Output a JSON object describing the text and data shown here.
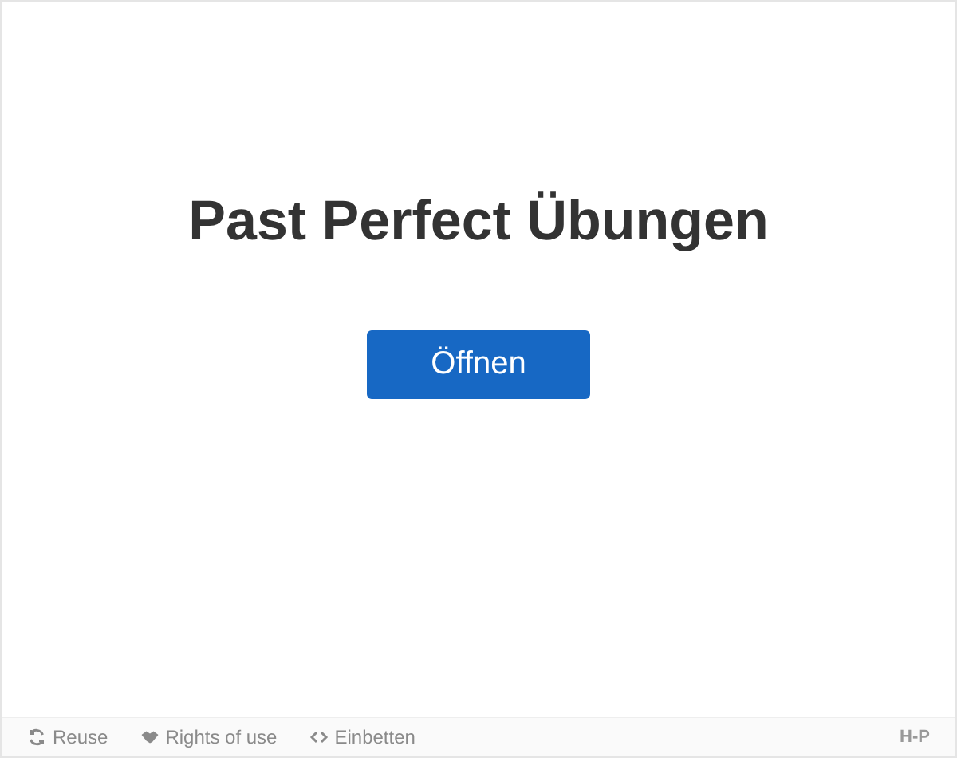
{
  "title": "Past Perfect Übungen",
  "open_button": "Öffnen",
  "footer": {
    "links": [
      {
        "kind": "reuse",
        "label": "Reuse"
      },
      {
        "kind": "rights",
        "label": "Rights of use"
      },
      {
        "kind": "embed",
        "label": "Einbetten"
      }
    ],
    "logo": "H-P"
  }
}
